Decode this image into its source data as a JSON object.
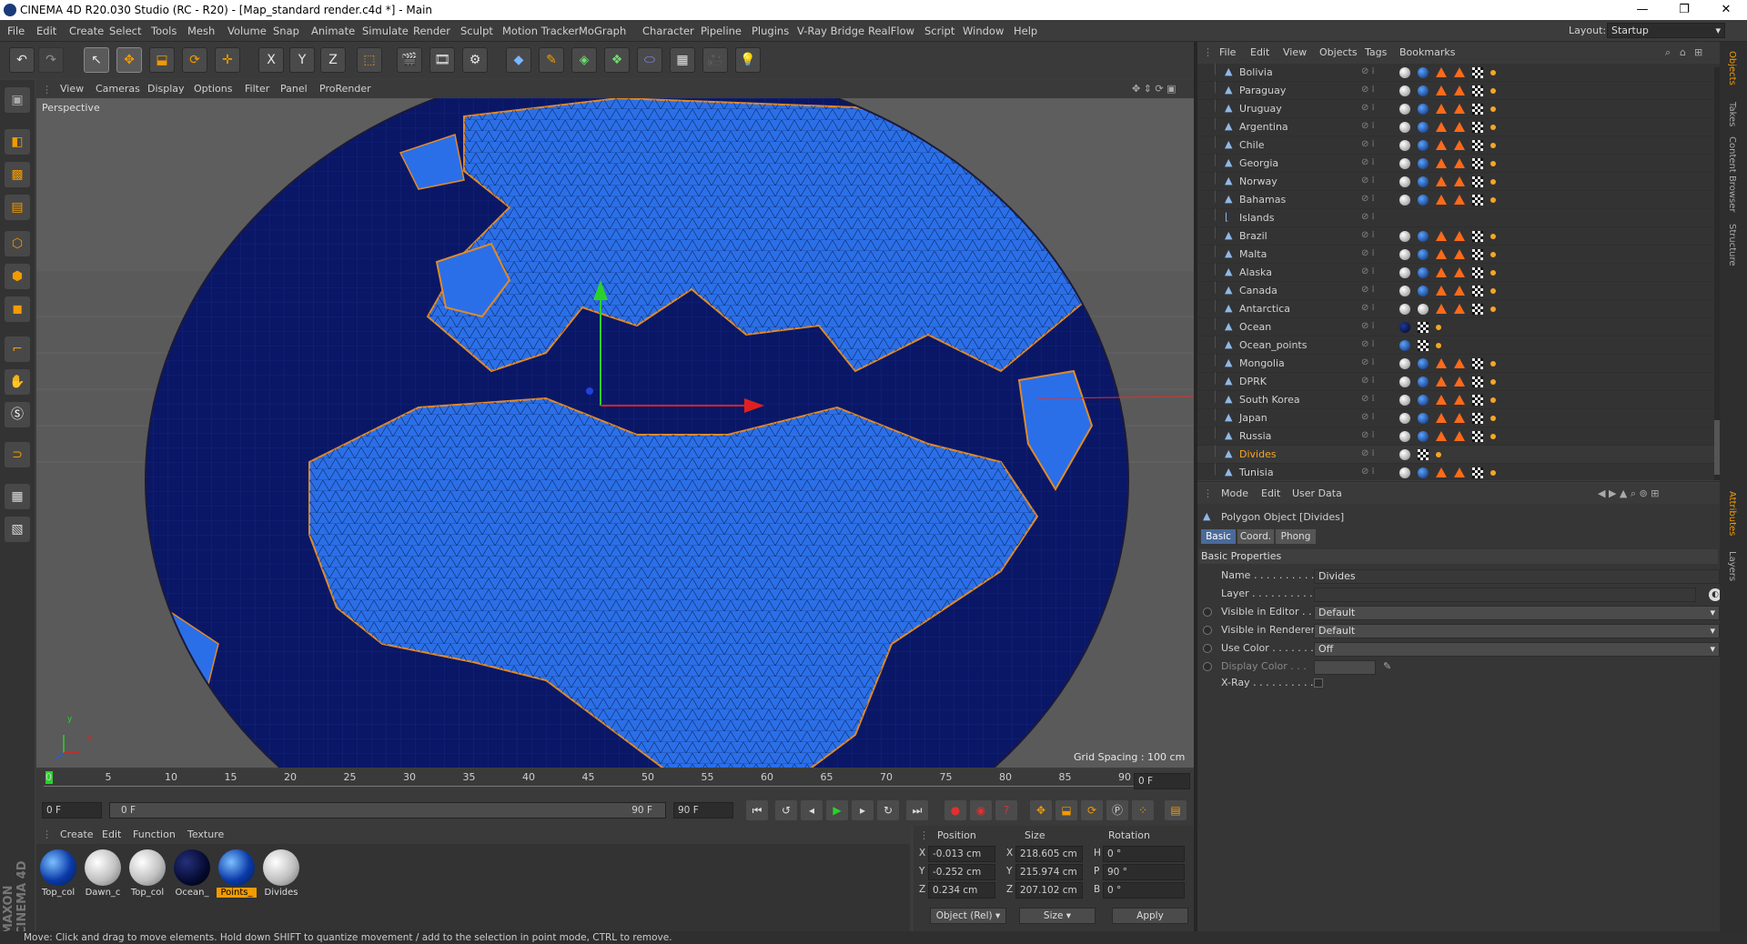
{
  "window": {
    "title": "CINEMA 4D R20.030 Studio (RC - R20) - [Map_standard render.c4d *] - Main",
    "minimize": "—",
    "maximize": "❐",
    "close": "✕"
  },
  "menu": [
    "File",
    "Edit",
    "Create",
    "Select",
    "Tools",
    "Mesh",
    "Volume",
    "Snap",
    "Animate",
    "Simulate",
    "Render",
    "Sculpt",
    "Motion Tracker",
    "MoGraph",
    "Character",
    "Pipeline",
    "Plugins",
    "V-Ray Bridge",
    "RealFlow",
    "Script",
    "Window",
    "Help"
  ],
  "layout": {
    "label": "Layout:",
    "value": "Startup"
  },
  "toolbar": {
    "x": "X",
    "y": "Y",
    "z": "Z"
  },
  "viewport": {
    "menu": [
      "View",
      "Cameras",
      "Display",
      "Options",
      "Filter",
      "Panel",
      "ProRender"
    ],
    "label": "Perspective",
    "grid_spacing": "Grid Spacing : 100 cm",
    "axis_y": "y",
    "axis_x": "x"
  },
  "timeline": {
    "ticks": [
      "0",
      "5",
      "10",
      "15",
      "20",
      "25",
      "30",
      "35",
      "40",
      "45",
      "50",
      "55",
      "60",
      "65",
      "70",
      "75",
      "80",
      "85",
      "90"
    ],
    "current_frame": "0 F",
    "start": "0 F",
    "range_start": "0 F",
    "range_end": "90 F",
    "end": "90 F",
    "preview_frame": "0 F"
  },
  "materials": {
    "menu": [
      "Create",
      "Edit",
      "Function",
      "Texture"
    ],
    "items": [
      {
        "name": "Top_col",
        "style": "blue"
      },
      {
        "name": "Dawn_c",
        "style": "white"
      },
      {
        "name": "Top_col",
        "style": "white"
      },
      {
        "name": "Ocean_",
        "style": "dark"
      },
      {
        "name": "Points_",
        "style": "blue",
        "selected": true
      },
      {
        "name": "Divides",
        "style": "white"
      }
    ]
  },
  "coords": {
    "headers": {
      "position": "Position",
      "size": "Size",
      "rotation": "Rotation"
    },
    "rows": [
      {
        "axis": "X",
        "pos": "-0.013 cm",
        "size_axis": "X",
        "size": "218.605 cm",
        "rot_axis": "H",
        "rot": "0 °"
      },
      {
        "axis": "Y",
        "pos": "-0.252 cm",
        "size_axis": "Y",
        "size": "215.974 cm",
        "rot_axis": "P",
        "rot": "90 °"
      },
      {
        "axis": "Z",
        "pos": "0.234 cm",
        "size_axis": "Z",
        "size": "207.102 cm",
        "rot_axis": "B",
        "rot": "0 °"
      }
    ],
    "mode": "Object (Rel)",
    "size_mode": "Size",
    "apply": "Apply"
  },
  "objects": {
    "menu": [
      "File",
      "Edit",
      "View",
      "Objects",
      "Tags",
      "Bookmarks"
    ],
    "items": [
      {
        "name": "Bolivia",
        "tags": "full"
      },
      {
        "name": "Paraguay",
        "tags": "full"
      },
      {
        "name": "Uruguay",
        "tags": "full"
      },
      {
        "name": "Argentina",
        "tags": "full"
      },
      {
        "name": "Chile",
        "tags": "full"
      },
      {
        "name": "Georgia",
        "tags": "full"
      },
      {
        "name": "Norway",
        "tags": "full"
      },
      {
        "name": "Bahamas",
        "tags": "full"
      },
      {
        "name": "Islands",
        "tags": "none"
      },
      {
        "name": "Brazil",
        "tags": "full"
      },
      {
        "name": "Malta",
        "tags": "full"
      },
      {
        "name": "Alaska",
        "tags": "full"
      },
      {
        "name": "Canada",
        "tags": "full"
      },
      {
        "name": "Antarctica",
        "tags": "white"
      },
      {
        "name": "Ocean",
        "tags": "ocean"
      },
      {
        "name": "Ocean_points",
        "tags": "points"
      },
      {
        "name": "Mongolia",
        "tags": "full"
      },
      {
        "name": "DPRK",
        "tags": "full"
      },
      {
        "name": "South Korea",
        "tags": "full"
      },
      {
        "name": "Japan",
        "tags": "full"
      },
      {
        "name": "Russia",
        "tags": "full"
      },
      {
        "name": "Divides",
        "tags": "divides",
        "selected": true
      },
      {
        "name": "Tunisia",
        "tags": "full"
      }
    ]
  },
  "attributes": {
    "menu": [
      "Mode",
      "Edit",
      "User Data"
    ],
    "title": "Polygon Object [Divides]",
    "tabs": [
      "Basic",
      "Coord.",
      "Phong"
    ],
    "section": "Basic Properties",
    "fields": [
      {
        "label": "Name . . . . . . . . . . .",
        "value": "Divides"
      },
      {
        "label": "Layer . . . . . . . . . . .",
        "value": ""
      },
      {
        "label": "Visible in Editor . . .",
        "value": "Default"
      },
      {
        "label": "Visible in Renderer",
        "value": "Default"
      },
      {
        "label": "Use Color . . . . . . .",
        "value": "Off"
      },
      {
        "label": "Display Color . . .",
        "value": ""
      },
      {
        "label": "X-Ray . . . . . . . . . . .",
        "value": ""
      }
    ]
  },
  "right_tabs": [
    "Objects",
    "Takes",
    "Content Browser",
    "Structure",
    "Attributes",
    "Layers"
  ],
  "status": "Move: Click and drag to move elements. Hold down SHIFT to quantize movement / add to the selection in point mode, CTRL to remove.",
  "brand": "MAXON CINEMA 4D"
}
